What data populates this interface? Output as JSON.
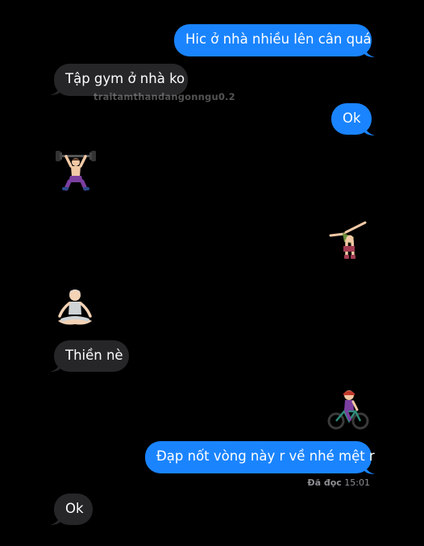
{
  "messages": [
    {
      "id": "m1",
      "direction": "sent",
      "text": "Hic ở nhà nhiều lên cân quá"
    },
    {
      "id": "m2",
      "direction": "received",
      "text": "Tập gym ở nhà ko"
    },
    {
      "id": "m3",
      "direction": "sent",
      "text": "Ok"
    },
    {
      "id": "m4",
      "direction": "received",
      "emoji": "person-lifting-weights"
    },
    {
      "id": "m5",
      "direction": "sent",
      "emoji": "person-cartwheeling"
    },
    {
      "id": "m6",
      "direction": "received",
      "emoji": "person-in-lotus-position"
    },
    {
      "id": "m7",
      "direction": "received",
      "text": "Thiền nè"
    },
    {
      "id": "m8",
      "direction": "sent",
      "emoji": "person-biking"
    },
    {
      "id": "m9",
      "direction": "sent",
      "text": "Đạp nốt vòng này r về nhé mệt r"
    },
    {
      "id": "m10",
      "direction": "received",
      "text": "Ok"
    }
  ],
  "watermark": "traitamthandangonngu0.2",
  "read_receipt": {
    "label": "Đã đọc",
    "time": "15:01"
  },
  "colors": {
    "background": "#000000",
    "sent_bubble": "#1a84ff",
    "received_bubble": "#262629",
    "receipt_text": "#8e8e93"
  }
}
